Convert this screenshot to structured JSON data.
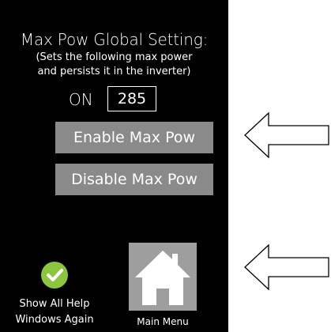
{
  "screen": {
    "title": "Max Pow Global Setting:",
    "subtitle_line1": "(Sets the following max power",
    "subtitle_line2": "and persists it in the inverter)",
    "status_label": "ON",
    "max_power_value": "285",
    "enable_button_label": "Enable Max Pow",
    "disable_button_label": "Disable Max Pow",
    "help_label_line1": "Show All Help",
    "help_label_line2": "Windows Again",
    "main_menu_label": "Main Menu"
  },
  "icons": {
    "check": "check-icon",
    "home": "home-icon",
    "arrow": "arrow-left-icon"
  },
  "colors": {
    "background": "#000000",
    "button": "#8a8a8a",
    "check": "#8cc63f",
    "home_tile": "#9e9e9e"
  }
}
